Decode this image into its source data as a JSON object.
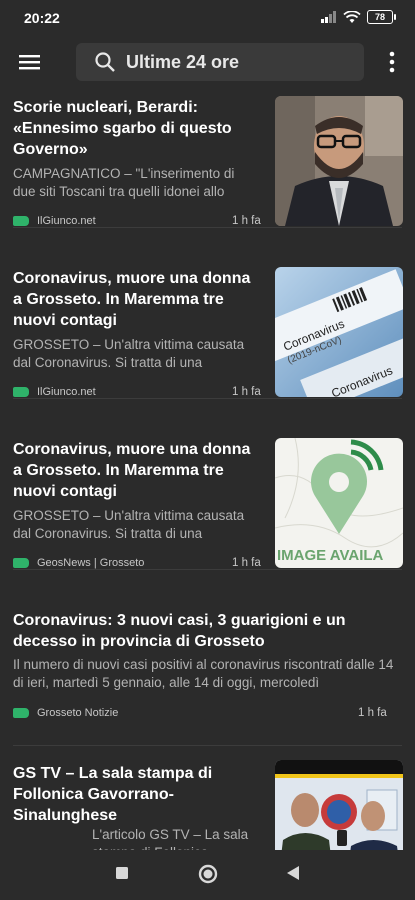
{
  "status": {
    "time": "20:22",
    "battery": "78"
  },
  "search": {
    "text": "Ultime 24 ore"
  },
  "articles": [
    {
      "title": "Scorie nucleari, Berardi: «Ennesimo sgarbo di questo Governo»",
      "snippet": "CAMPAGNATICO – \"L'inserimento di due siti Toscani tra quelli idonei allo",
      "source": "IlGiunco.net",
      "time": "1 h fa"
    },
    {
      "title": "Coronavirus, muore una donna a Grosseto. In Maremma tre nuovi contagi",
      "snippet": "GROSSETO – Un'altra vittima causata dal Coronavirus. Si tratta di una",
      "source": "IlGiunco.net",
      "time": "1 h fa",
      "thumb_text_1": "Coronavirus",
      "thumb_text_2": "(2019-nCoV)"
    },
    {
      "title": "Coronavirus, muore una donna a Grosseto. In Maremma tre nuovi contagi",
      "snippet": "GROSSETO – Un'altra vittima causata dal Coronavirus. Si tratta di una",
      "source": "GeosNews | Grosseto",
      "time": "1 h fa",
      "thumb_text": "IMAGE AVAILA"
    },
    {
      "title": "Coronavirus: 3 nuovi casi, 3 guarigioni e un decesso in provincia di Grosseto",
      "snippet": "Il numero di nuovi casi positivi al coronavirus riscontrati dalle 14 di ieri, martedì 5 gennaio, alle 14 di oggi, mercoledì",
      "source": "Grosseto Notizie",
      "time": "1 h fa"
    },
    {
      "title": "GS TV – La sala stampa di Follonica Gavorrano-Sinalunghese",
      "snippet": "L'articolo GS TV – La sala stampa di Follonica",
      "source": "",
      "time": ""
    }
  ]
}
